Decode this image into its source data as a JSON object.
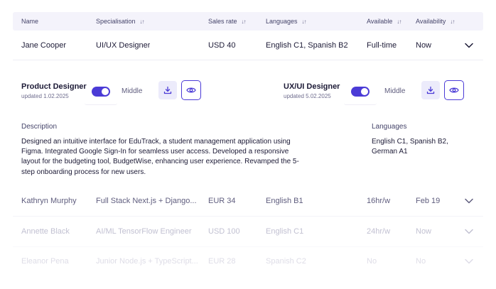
{
  "columns": {
    "name": "Name",
    "specialisation": "Specialisation",
    "sales_rate": "Sales rate",
    "languages": "Languages",
    "available": "Available",
    "availability": "Availability"
  },
  "sort_icon": "sort-arrows-icon",
  "rows": [
    {
      "name": "Jane Cooper",
      "specialisation": "UI/UX Designer",
      "sales_rate": "USD 40",
      "languages": "English C1, Spanish B2",
      "available": "Full-time",
      "availability": "Now"
    },
    {
      "name": "Kathryn Murphy",
      "specialisation": "Full Stack Next.js + Django...",
      "sales_rate": "EUR 34",
      "languages": "English B1",
      "available": "16hr/w",
      "availability": "Feb 19"
    },
    {
      "name": "Annette Black",
      "specialisation": "AI/ML TensorFlow Engineer",
      "sales_rate": "USD 100",
      "languages": "English C1",
      "available": "24hr/w",
      "availability": "Now"
    },
    {
      "name": "Eleanor Pena",
      "specialisation": "Junior Node.js + TypeScript...",
      "sales_rate": "EUR 28",
      "languages": "Spanish C2",
      "available": "No",
      "availability": "No"
    }
  ],
  "expanded": {
    "roles": [
      {
        "title": "Product Designer",
        "updated": "updated 1.02.2025",
        "level": "Middle",
        "enabled": true
      },
      {
        "title": "UX/UI Designer",
        "updated": "updated 5.02.2025",
        "level": "Middle",
        "enabled": true
      }
    ],
    "description_label": "Description",
    "description": "Designed an intuitive interface for EduTrack, a student management application using Figma. Integrated Google Sign-In for seamless user access. Developed a responsive layout for the budgeting tool, BudgetWise, enhancing user experience. Revamped the 5-step onboarding process for new users.",
    "languages_label": "Languages",
    "languages": "English C1, Spanish B2, German A1"
  },
  "colors": {
    "accent": "#4b3bd6",
    "header_bg": "#f4f3fb",
    "text": "#1c1a36"
  }
}
